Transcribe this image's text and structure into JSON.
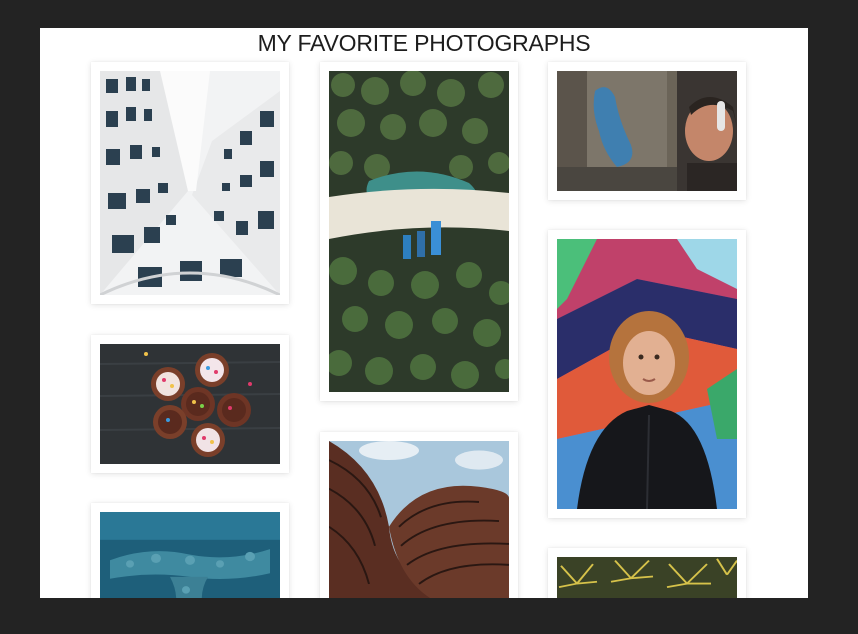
{
  "gallery": {
    "title": "MY FAVORITE PHOTOGRAPHS",
    "photos": [
      {
        "id": "building-looking-up",
        "subject": "white curved apartment facade looking up"
      },
      {
        "id": "aerial-beach",
        "subject": "aerial view of palm trees, beach and boats"
      },
      {
        "id": "graffiti-headphones",
        "subject": "graffiti wall with person wearing headphones"
      },
      {
        "id": "cupcakes",
        "subject": "decorated cupcakes on dark wood"
      },
      {
        "id": "girl-graffiti",
        "subject": "person in hoodie in front of colorful graffiti"
      },
      {
        "id": "curved-architecture",
        "subject": "curved brown building against sky"
      },
      {
        "id": "underwater-reef",
        "subject": "blue sea with reef from above"
      },
      {
        "id": "yellow-palms",
        "subject": "yellow palm fronds"
      }
    ]
  }
}
